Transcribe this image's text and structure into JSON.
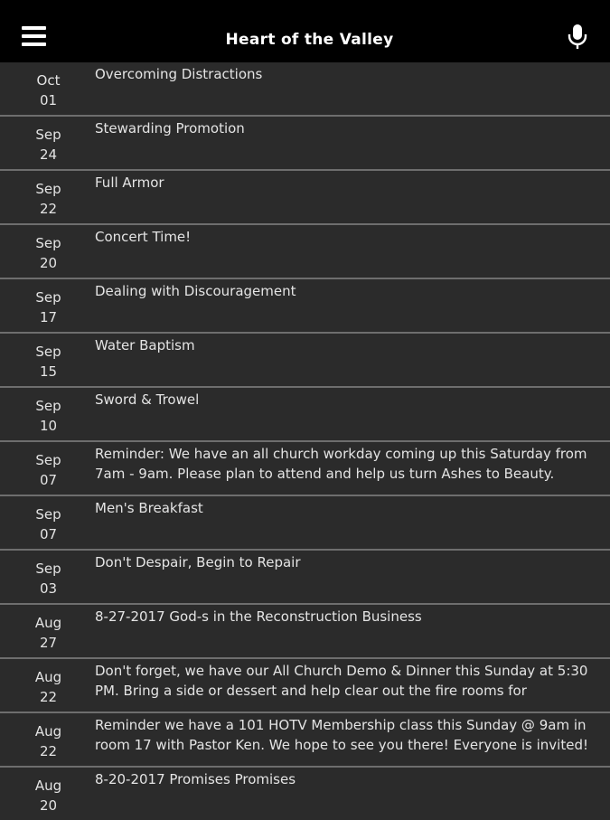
{
  "header": {
    "title": "Heart of the Valley",
    "menu_icon": "hamburger-menu-icon",
    "mic_icon": "microphone-icon"
  },
  "items": [
    {
      "month": "Oct",
      "day": "01",
      "text": "Overcoming Distractions"
    },
    {
      "month": "Sep",
      "day": "24",
      "text": "Stewarding Promotion"
    },
    {
      "month": "Sep",
      "day": "22",
      "text": "Full Armor"
    },
    {
      "month": "Sep",
      "day": "20",
      "text": "Concert Time!"
    },
    {
      "month": "Sep",
      "day": "17",
      "text": "Dealing with Discouragement"
    },
    {
      "month": "Sep",
      "day": "15",
      "text": "Water Baptism"
    },
    {
      "month": "Sep",
      "day": "10",
      "text": "Sword & Trowel"
    },
    {
      "month": "Sep",
      "day": "07",
      "text": "Reminder: We have an all church workday coming up this Saturday from\n7am - 9am. Please plan to attend and help us turn Ashes to Beauty."
    },
    {
      "month": "Sep",
      "day": "07",
      "text": "Men's Breakfast"
    },
    {
      "month": "Sep",
      "day": "03",
      "text": "Don't Despair, Begin to Repair"
    },
    {
      "month": "Aug",
      "day": "27",
      "text": "8-27-2017 God-s in the Reconstruction Business"
    },
    {
      "month": "Aug",
      "day": "22",
      "text": "Don't forget, we have our All Church Demo & Dinner this Sunday at 5:30\nPM. Bring a side or dessert and help clear out the fire rooms for"
    },
    {
      "month": "Aug",
      "day": "22",
      "text": "Reminder we have a 101 HOTV Membership class this Sunday @ 9am in\nroom 17 with Pastor Ken. We hope to see you there! Everyone is invited!"
    },
    {
      "month": "Aug",
      "day": "20",
      "text": "8-20-2017 Promises Promises"
    }
  ]
}
